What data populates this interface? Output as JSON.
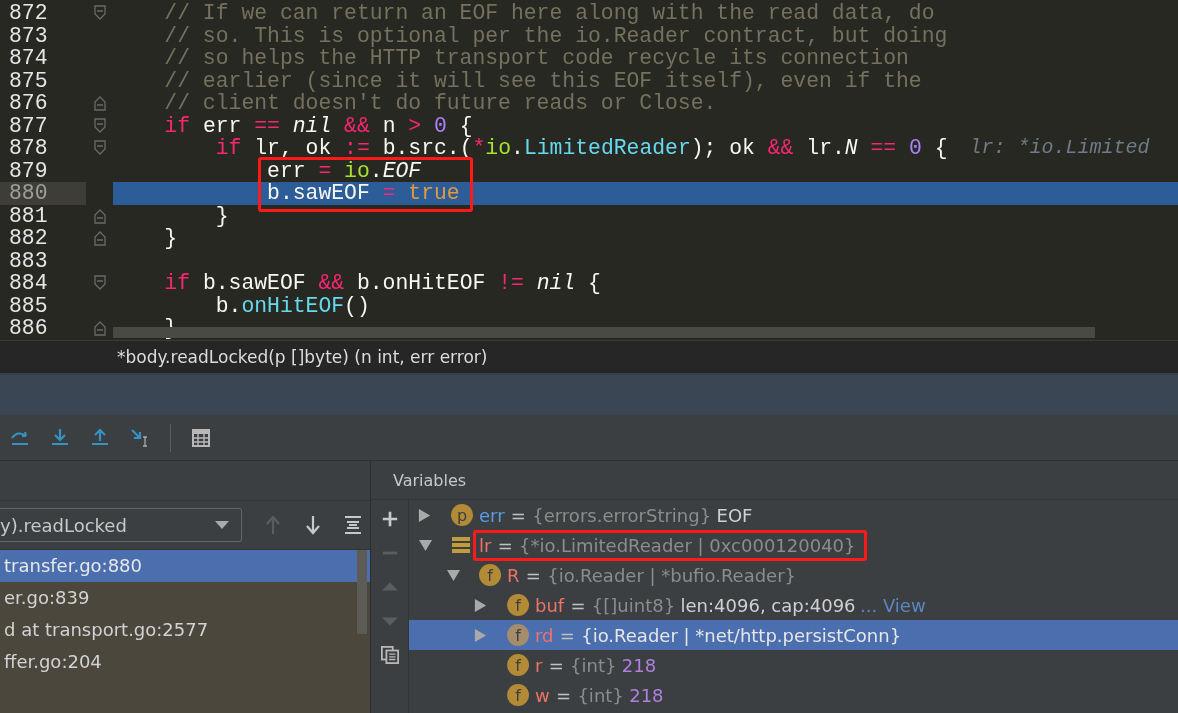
{
  "editor": {
    "highlight_box": true,
    "lines": [
      {
        "number": "872",
        "kind": "fold_start",
        "current": false,
        "tokens": [
          {
            "kind": "comment",
            "text": "    // If we can return an EOF here along with the read data, do"
          }
        ]
      },
      {
        "number": "873",
        "kind": "plain",
        "current": false,
        "tokens": [
          {
            "kind": "comment",
            "text": "    // so. This is optional per the io.Reader contract, but doing"
          }
        ]
      },
      {
        "number": "874",
        "kind": "plain",
        "current": false,
        "tokens": [
          {
            "kind": "comment",
            "text": "    // so helps the HTTP transport code recycle its connection"
          }
        ]
      },
      {
        "number": "875",
        "kind": "plain",
        "current": false,
        "tokens": [
          {
            "kind": "comment",
            "text": "    // earlier (since it will see this EOF itself), even if the"
          }
        ]
      },
      {
        "number": "876",
        "kind": "fold_end",
        "current": false,
        "tokens": [
          {
            "kind": "comment",
            "text": "    // client doesn't do future reads or Close."
          }
        ]
      },
      {
        "number": "877",
        "kind": "fold_start",
        "current": false,
        "tokens": [
          {
            "kind": "keyword",
            "text": "    if"
          },
          {
            "kind": "plain",
            "text": " err "
          },
          {
            "kind": "keyword",
            "text": "=="
          },
          {
            "kind": "italic",
            "text": " nil "
          },
          {
            "kind": "keyword",
            "text": "&&"
          },
          {
            "kind": "plain",
            "text": " n "
          },
          {
            "kind": "keyword",
            "text": ">"
          },
          {
            "kind": "number",
            "text": " 0"
          },
          {
            "kind": "plain",
            "text": " {"
          }
        ]
      },
      {
        "number": "878",
        "kind": "fold_start",
        "current": false,
        "hint": "lr: *io.Limited",
        "tokens": [
          {
            "kind": "keyword",
            "text": "        if"
          },
          {
            "kind": "plain",
            "text": " lr, ok "
          },
          {
            "kind": "keyword",
            "text": ":="
          },
          {
            "kind": "plain",
            "text": " b.src.("
          },
          {
            "kind": "keyword",
            "text": "*"
          },
          {
            "kind": "package",
            "text": "io"
          },
          {
            "kind": "plain",
            "text": "."
          },
          {
            "kind": "type",
            "text": "LimitedReader"
          },
          {
            "kind": "plain",
            "text": "); ok "
          },
          {
            "kind": "keyword",
            "text": "&&"
          },
          {
            "kind": "plain",
            "text": " lr."
          },
          {
            "kind": "italic",
            "text": "N "
          },
          {
            "kind": "keyword",
            "text": "=="
          },
          {
            "kind": "number",
            "text": " 0"
          },
          {
            "kind": "plain",
            "text": " {"
          }
        ]
      },
      {
        "number": "879",
        "kind": "plain",
        "current": false,
        "tokens": [
          {
            "kind": "plain",
            "text": "            err "
          },
          {
            "kind": "keyword",
            "text": "="
          },
          {
            "kind": "package",
            "text": " io"
          },
          {
            "kind": "plain",
            "text": "."
          },
          {
            "kind": "italic",
            "text": "EOF"
          }
        ]
      },
      {
        "number": "880",
        "kind": "plain",
        "current": true,
        "tokens": [
          {
            "kind": "plain",
            "text": "            b.sawEOF "
          },
          {
            "kind": "keyword",
            "text": "="
          },
          {
            "kind": "constant",
            "text": " true"
          }
        ]
      },
      {
        "number": "881",
        "kind": "fold_end",
        "current": false,
        "tokens": [
          {
            "kind": "plain",
            "text": "        }"
          }
        ]
      },
      {
        "number": "882",
        "kind": "fold_end",
        "current": false,
        "tokens": [
          {
            "kind": "plain",
            "text": "    }"
          }
        ]
      },
      {
        "number": "883",
        "kind": "plain",
        "current": false
      },
      {
        "number": "884",
        "kind": "fold_start",
        "current": false,
        "tokens": [
          {
            "kind": "keyword",
            "text": "    if"
          },
          {
            "kind": "plain",
            "text": " b.sawEOF "
          },
          {
            "kind": "keyword",
            "text": "&&"
          },
          {
            "kind": "plain",
            "text": " b.onHitEOF "
          },
          {
            "kind": "keyword",
            "text": "!="
          },
          {
            "kind": "italic",
            "text": " nil"
          },
          {
            "kind": "plain",
            "text": " {"
          }
        ]
      },
      {
        "number": "885",
        "kind": "plain",
        "current": false,
        "tokens": [
          {
            "kind": "plain",
            "text": "        b."
          },
          {
            "kind": "type",
            "text": "onHitEOF"
          },
          {
            "kind": "plain",
            "text": "()"
          }
        ]
      },
      {
        "number": "886",
        "kind": "fold_end",
        "current": false,
        "tokens": [
          {
            "kind": "plain",
            "text": "    }"
          }
        ]
      }
    ]
  },
  "breadcrumb": "*body.readLocked(p []byte) (n int, err error)",
  "frames": {
    "dropdown": "y).readLocked",
    "items": [
      {
        "text": "transfer.go:880",
        "selected": true
      },
      {
        "text": "er.go:839",
        "selected": false
      },
      {
        "text": "d at transport.go:2577",
        "selected": false
      },
      {
        "text": "ffer.go:204",
        "selected": false
      }
    ]
  },
  "variables": {
    "title": "Variables",
    "items": [
      {
        "kind": "param",
        "badge": "p",
        "name": "err",
        "operator": "=",
        "type": "{errors.errorString}",
        "value": "EOF",
        "numeric": false,
        "expanded": false,
        "selected": false,
        "boxed": false
      },
      {
        "kind": "local",
        "name": "lr",
        "operator": "=",
        "type": "{*io.LimitedReader | 0xc000120040}",
        "expanded": true,
        "selected": false,
        "boxed": true,
        "children": [
          {
            "kind": "field",
            "badge": "f",
            "name": "R",
            "operator": "=",
            "type": "{io.Reader | *bufio.Reader}",
            "expanded": true,
            "selected": false,
            "boxed": false,
            "children": [
              {
                "kind": "field",
                "badge": "f",
                "name": "buf",
                "operator": "=",
                "type": "{[]uint8}",
                "value": "len:4096, cap:4096",
                "numeric": false,
                "link": "... View",
                "expanded": false,
                "selected": false,
                "boxed": false
              },
              {
                "kind": "field",
                "badge": "f",
                "name": "rd",
                "operator": "=",
                "type": "{io.Reader | *net/http.persistConn}",
                "expanded": false,
                "selected": true,
                "boxed": false
              },
              {
                "kind": "field",
                "badge": "f",
                "name": "r",
                "operator": "=",
                "type": "{int}",
                "value": "218",
                "numeric": true,
                "selected": false,
                "boxed": false
              },
              {
                "kind": "field",
                "badge": "f",
                "name": "w",
                "operator": "=",
                "type": "{int}",
                "value": "218",
                "numeric": true,
                "selected": false,
                "boxed": false
              }
            ]
          }
        ]
      }
    ]
  }
}
